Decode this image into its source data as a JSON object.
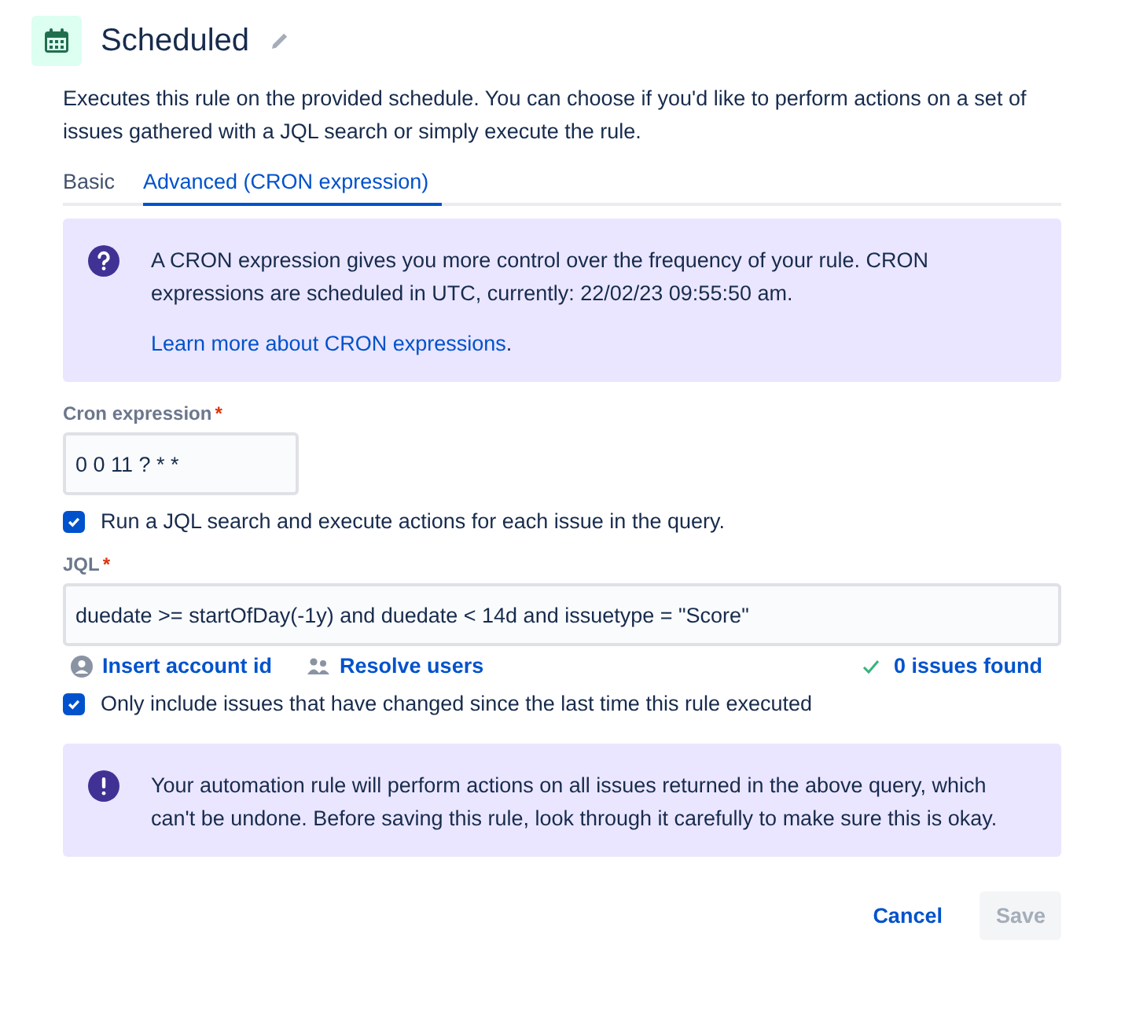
{
  "header": {
    "title": "Scheduled"
  },
  "description": "Executes this rule on the provided schedule. You can choose if you'd like to perform actions on a set of issues gathered with a JQL search or simply execute the rule.",
  "tabs": [
    {
      "label": "Basic",
      "selected": false
    },
    {
      "label": "Advanced (CRON expression)",
      "selected": true
    }
  ],
  "info": {
    "text": "A CRON expression gives you more control over the frequency of your rule. CRON expressions are scheduled in UTC, currently: 22/02/23 09:55:50 am.",
    "link": "Learn more about CRON expressions",
    "link_suffix": "."
  },
  "cron": {
    "label": "Cron expression",
    "required_mark": "*",
    "value": "0 0 11 ? * *"
  },
  "run_jql": {
    "label": "Run a JQL search and execute actions for each issue in the query.",
    "checked": true
  },
  "jql": {
    "label": "JQL",
    "required_mark": "*",
    "value": "duedate >= startOfDay(-1y) and duedate < 14d and issuetype = \"Score\""
  },
  "jql_actions": [
    {
      "label": "Insert account id",
      "kind": "account"
    },
    {
      "label": "Resolve users",
      "kind": "users"
    }
  ],
  "issues_found": "0 issues found",
  "only_changed": {
    "label": "Only include issues that have changed since the last time this rule executed",
    "checked": true
  },
  "warning": "Your automation rule will perform actions on all issues returned in the above query, which can't be undone. Before saving this rule, look through it carefully to make sure this is okay.",
  "buttons": [
    {
      "label": "Cancel",
      "kind": "subtle",
      "disabled": false
    },
    {
      "label": "Save",
      "kind": "primary",
      "disabled": true
    }
  ]
}
